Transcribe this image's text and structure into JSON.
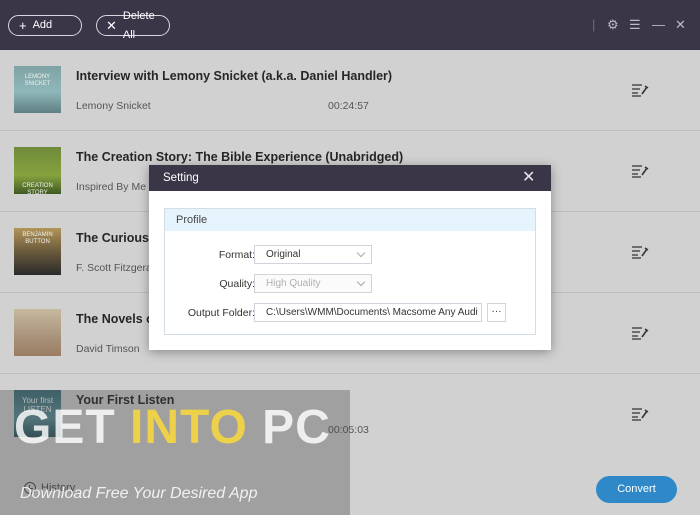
{
  "toolbar": {
    "add_label": "Add",
    "delete_all_label": "Delete All",
    "add_icon": "plus-icon",
    "delete_icon": "x-icon"
  },
  "window_controls": [
    "gear-icon",
    "menu-icon",
    "minimize-icon",
    "close-icon"
  ],
  "tracks": [
    {
      "title": "Interview with Lemony Snicket (a.k.a. Daniel Handler)",
      "author": "Lemony Snicket",
      "duration": "00:24:57",
      "cover_text": "LEMONY SNICKET"
    },
    {
      "title": "The Creation Story: The Bible Experience (Unabridged)",
      "author": "Inspired By Me",
      "duration": "",
      "cover_text": "CREATION STORY"
    },
    {
      "title": "The Curious",
      "author": "F. Scott Fitzgera",
      "duration": "",
      "cover_text": "BENJAMIN BUTTON"
    },
    {
      "title": "The Novels o",
      "author": "David Timson",
      "duration": "",
      "cover_text": ""
    },
    {
      "title": "Your First Listen",
      "author": "",
      "duration": "00:05:03",
      "cover_text": "Your first LISTEN"
    }
  ],
  "bottom": {
    "history_label": "History",
    "convert_label": "Convert"
  },
  "watermark": {
    "main_a": "GET ",
    "main_b": "INTO",
    "main_c": " PC",
    "sub": "Download Free Your Desired App"
  },
  "dialog": {
    "title": "Setting",
    "section": "Profile",
    "format_label": "Format:",
    "format_value": "Original",
    "quality_label": "Quality:",
    "quality_value": "High Quality",
    "output_label": "Output Folder:",
    "output_value": "C:\\Users\\WMM\\Documents\\ Macsome Any Audi",
    "browse_label": "···"
  },
  "colors": {
    "titlebar": "#3a3648",
    "accent": "#2f88c8",
    "panel_header": "#e5f4fc"
  }
}
